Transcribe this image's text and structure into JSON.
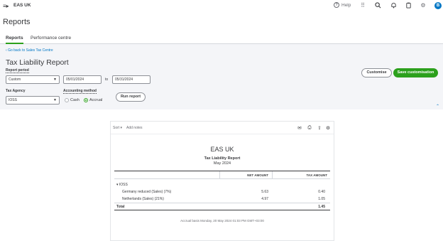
{
  "topbar": {
    "company": "EAS UK",
    "help_label": "Help",
    "avatar_letter": "B",
    "icons": [
      "menu-icon",
      "help-icon",
      "apps-grid-icon",
      "search-icon",
      "bell-icon",
      "clipboard-icon",
      "gear-icon"
    ]
  },
  "page": {
    "title": "Reports",
    "tabs": [
      {
        "label": "Reports",
        "active": true
      },
      {
        "label": "Performance centre",
        "active": false
      }
    ]
  },
  "filters": {
    "back_link": "Go back to Sales Tax Centre",
    "report_title": "Tax Liability Report",
    "report_period_label": "Report period",
    "report_period_value": "Custom",
    "date_from": "05/01/2024",
    "to_label": "to",
    "date_to": "05/31/2024",
    "tax_agency_label": "Tax Agency",
    "tax_agency_value": "IOSS",
    "accounting_method_label": "Accounting method",
    "method_options": [
      {
        "label": "Cash",
        "selected": false
      },
      {
        "label": "Accrual",
        "selected": true
      }
    ],
    "run_report": "Run report",
    "customise": "Customise",
    "save_customisation": "Save customisation"
  },
  "report": {
    "sort_label": "Sort",
    "add_notes_label": "Add notes",
    "company": "EAS UK",
    "title": "Tax Liability Report",
    "period": "May 2024",
    "columns": [
      "NET AMOUNT",
      "TAX AMOUNT"
    ],
    "group": "IOSS",
    "rows": [
      {
        "label": "Germany reduced (Sales) (7%)",
        "net": "5.63",
        "tax": "0.40"
      },
      {
        "label": "Netherlands (Sales) (21%)",
        "net": "4.97",
        "tax": "1.05"
      }
    ],
    "total": {
      "label": "Total",
      "tax": "1.45"
    },
    "footer": "Accrual basis  Monday, 20 May 2024  01:03 PM GMT+03:00"
  },
  "colors": {
    "accent_green": "#2ca01c",
    "link_blue": "#0077c5",
    "panel_bg": "#f4f5f8",
    "text": "#393a3d"
  }
}
